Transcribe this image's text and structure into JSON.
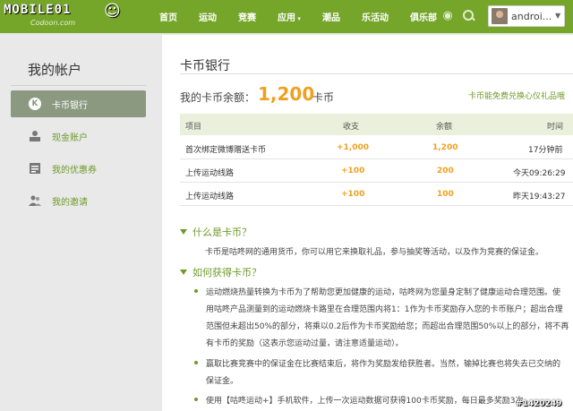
{
  "watermark": {
    "top_left": "MOBILE01",
    "bottom_right": "#1420249"
  },
  "logo": {
    "sub": "Codoon.com"
  },
  "nav": {
    "items": [
      "首页",
      "运动",
      "竞赛",
      "应用",
      "潮品",
      "乐活动",
      "俱乐部"
    ]
  },
  "user": {
    "name": "androi..."
  },
  "sidebar": {
    "title": "我的帐户",
    "items": [
      {
        "label": "卡币银行",
        "icon": "k-coin-icon",
        "active": true
      },
      {
        "label": "现金账户",
        "icon": "cash-icon",
        "active": false
      },
      {
        "label": "我的优惠券",
        "icon": "coupon-icon",
        "active": false
      },
      {
        "label": "我的邀请",
        "icon": "people-icon",
        "active": false
      }
    ]
  },
  "main": {
    "title": "卡币银行",
    "balance_label": "我的卡币余额：",
    "balance_value": "1,200",
    "balance_unit": "卡币",
    "promo_link": "卡币能免费兑换心仪礼品哦",
    "table": {
      "headers": [
        "项目",
        "收支",
        "余额",
        "时间"
      ],
      "rows": [
        {
          "item": "首次绑定微博赠送卡币",
          "change": "+1,000",
          "balance": "1,200",
          "time": "17分钟前"
        },
        {
          "item": "上传运动线路",
          "change": "+100",
          "balance": "200",
          "time": "今天09:26:29"
        },
        {
          "item": "上传运动线路",
          "change": "+100",
          "balance": "100",
          "time": "昨天19:43:27"
        }
      ]
    },
    "what_title": "什么是卡币？",
    "what_text": "卡币是咕咚网的通用货币，你可以用它来换取礼品，参与抽奖等活动，以及作为竞赛的保证金。",
    "how_title": "如何获得卡币？",
    "how_bullets": [
      {
        "lines": [
          "运动燃烧热量转换为卡币为了帮助您更加健康的运动，咕咚网为您量身定制了健康运动合理范围。使",
          "用咕咚产品测量到的运动燃烧卡路里在合理范围内将1：1作为卡币奖励存入您的卡币账户；超出合理",
          "范围但未超出50%的部分，将乘以0.2后作为卡币奖励给您；而超出合理范围50%以上的部分，将不再",
          "有卡币的奖励（这表示您运动过量，请注意适量运动）。"
        ]
      },
      {
        "lines": [
          "赢取比赛竞赛中的保证金在比赛结束后，将作为奖励发给获胜者。当然，输掉比赛也将失去已交纳的",
          "保证金。"
        ]
      },
      {
        "lines": [
          "使用【咕咚运动+】手机软件，上传一次运动数据可获得100卡币奖励，每日最多奖励3次。"
        ]
      }
    ]
  }
}
